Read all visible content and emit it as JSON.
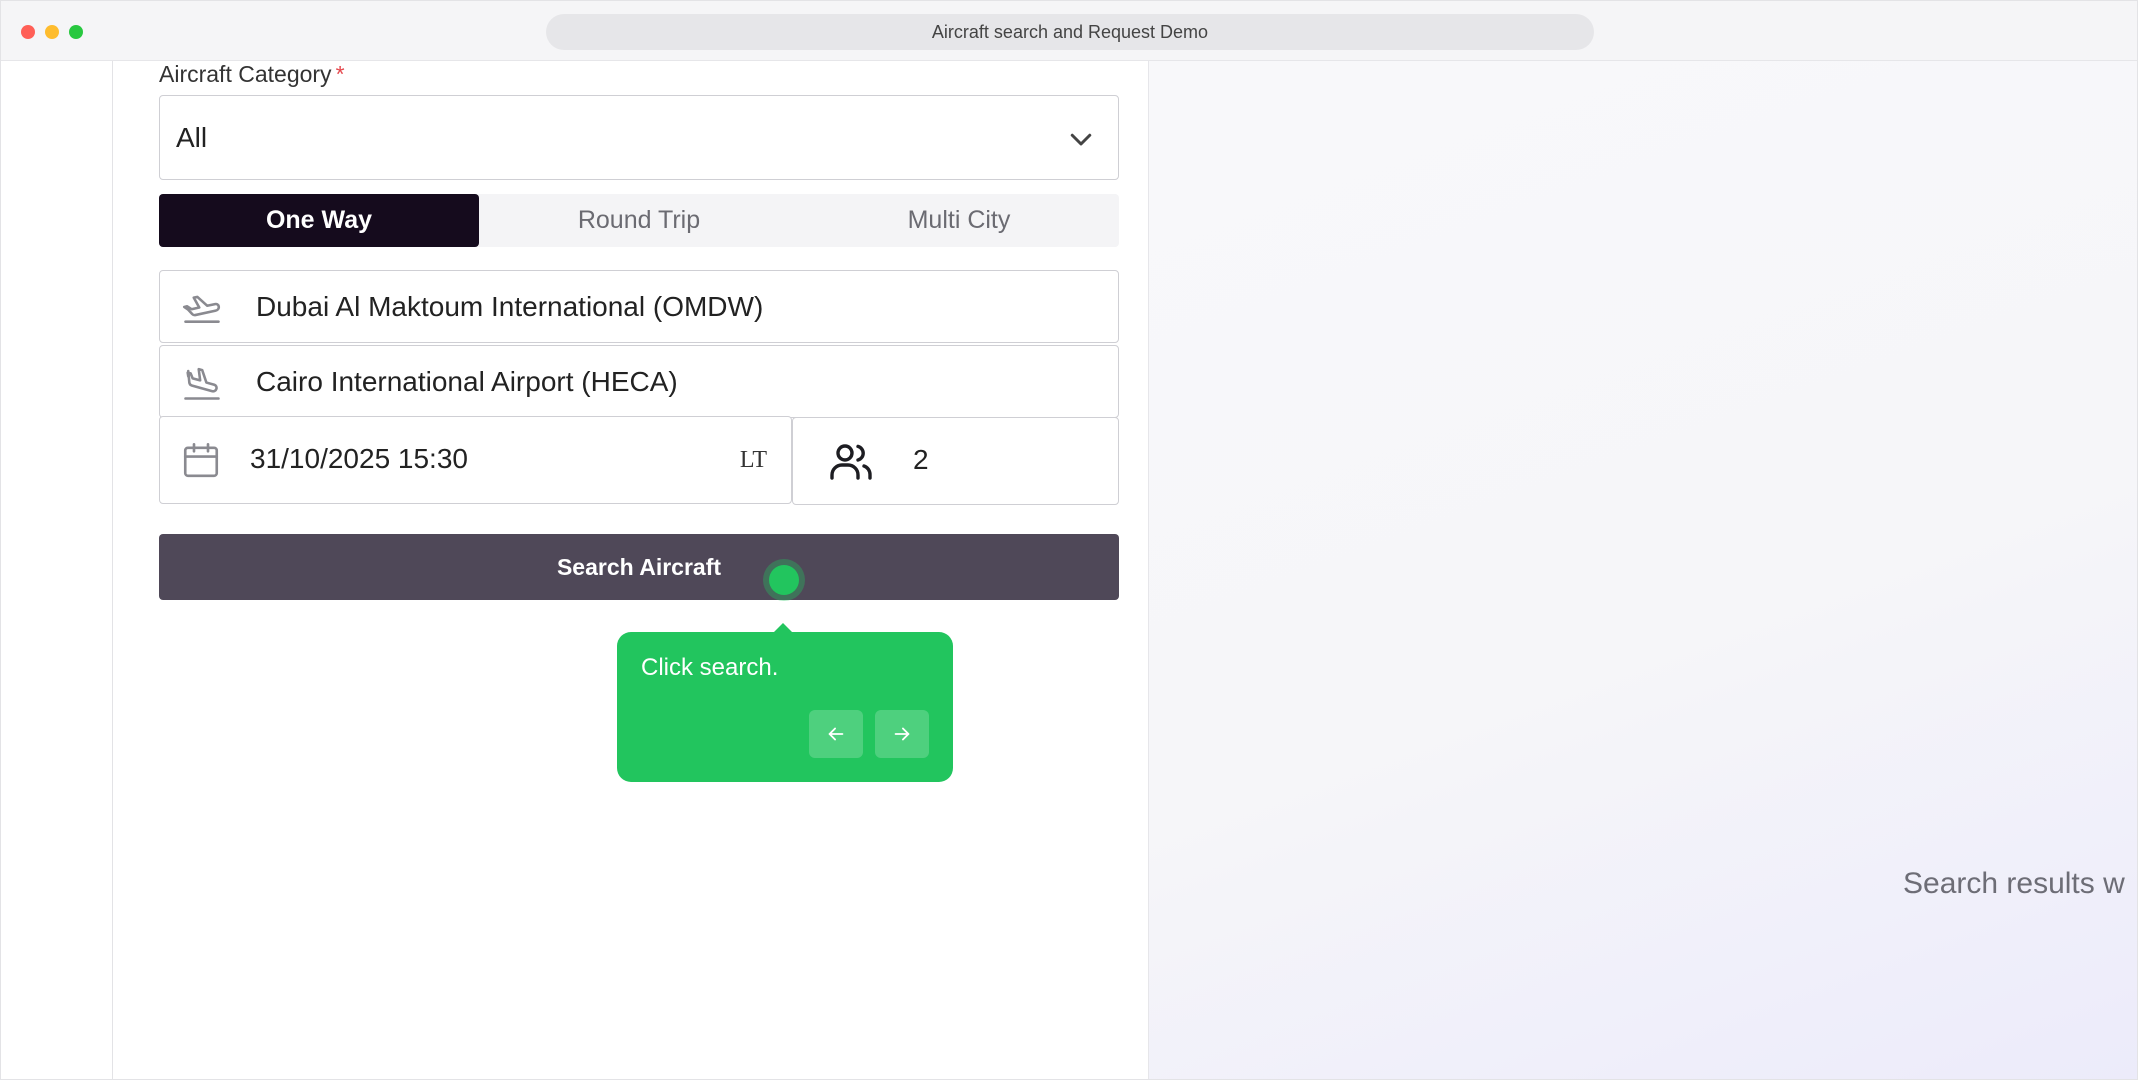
{
  "window": {
    "title": "Aircraft search and Request Demo"
  },
  "form": {
    "category_label": "Aircraft Category",
    "required_mark": "*",
    "category_value": "All",
    "trip_types": [
      {
        "label": "One Way",
        "active": true
      },
      {
        "label": "Round Trip",
        "active": false
      },
      {
        "label": "Multi City",
        "active": false
      }
    ],
    "from_airport": "Dubai Al Maktoum International (OMDW)",
    "to_airport": "Cairo International Airport (HECA)",
    "datetime": "31/10/2025 15:30",
    "time_zone": "LT",
    "passengers": "2",
    "search_button": "Search Aircraft"
  },
  "results": {
    "placeholder": "Search results w"
  },
  "walkthrough": {
    "tooltip_text": "Click search.",
    "prev_icon": "arrow-left-icon",
    "next_icon": "arrow-right-icon",
    "accent_color": "#22c55e"
  },
  "icons": {
    "dropdown": "chevron-down-icon",
    "from": "plane-takeoff-icon",
    "to": "plane-landing-icon",
    "date": "calendar-icon",
    "passengers": "users-icon"
  }
}
